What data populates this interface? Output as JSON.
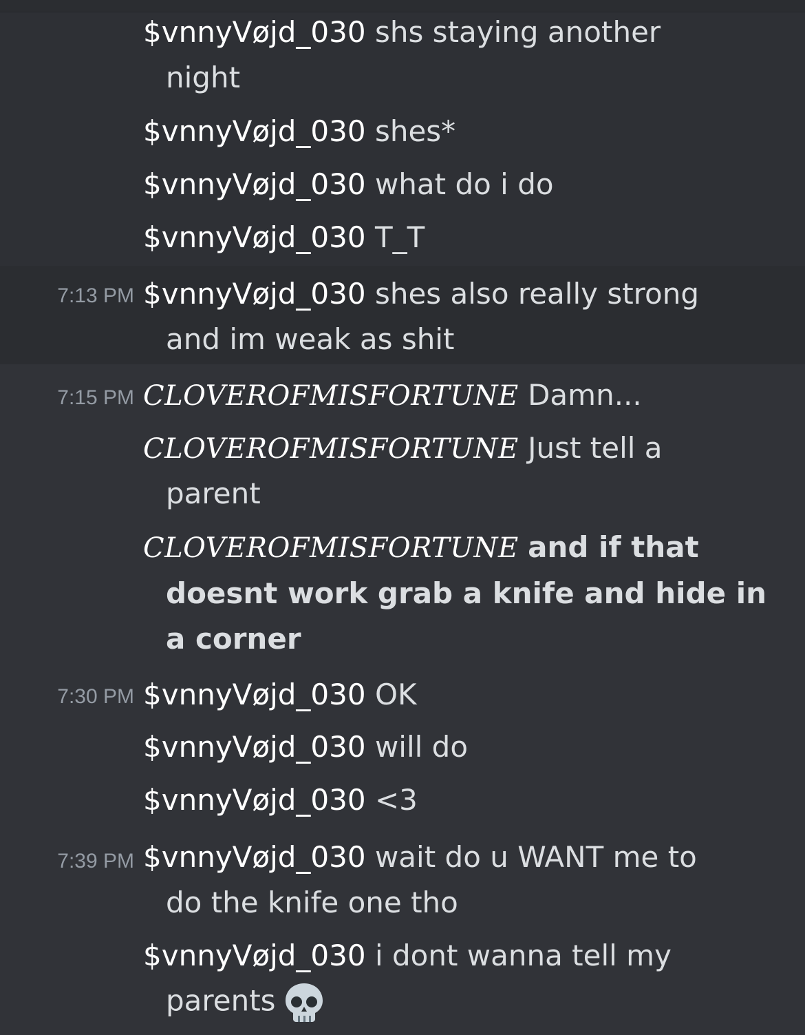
{
  "users": {
    "a": "$vnnyVøjd_030",
    "b": "CLOVEROFMISFORTUNE"
  },
  "messages": [
    {
      "user": "$vnnyVøjd_030",
      "line1": "shs staying another",
      "line2": "night"
    },
    {
      "user": "$vnnyVøjd_030",
      "line1": "shes*"
    },
    {
      "user": "$vnnyVøjd_030",
      "line1": "what do i do"
    },
    {
      "user": "$vnnyVøjd_030",
      "line1": "T_T"
    },
    {
      "time": "7:13 PM",
      "user": "$vnnyVøjd_030",
      "line1": "shes also really strong",
      "line2": "and im weak as shit"
    },
    {
      "time": "7:15 PM",
      "user": "CLOVEROFMISFORTUNE",
      "line1": "Damn..."
    },
    {
      "user": "CLOVEROFMISFORTUNE",
      "line1": "Just tell a",
      "line2": "parent"
    },
    {
      "user": "CLOVEROFMISFORTUNE",
      "line1": "and if that",
      "line2": "doesnt work grab a knife and hide in",
      "line3": "a corner"
    },
    {
      "time": "7:30 PM",
      "user": "$vnnyVøjd_030",
      "line1": "OK"
    },
    {
      "user": "$vnnyVøjd_030",
      "line1": "will do"
    },
    {
      "user": "$vnnyVøjd_030",
      "line1": "<3"
    },
    {
      "time": "7:39 PM",
      "user": "$vnnyVøjd_030",
      "line1": "wait do u WANT me to",
      "line2": "do the knife one tho"
    },
    {
      "user": "$vnnyVøjd_030",
      "line1": "i dont wanna tell my",
      "line2": "parents",
      "emoji": "skull-icon"
    }
  ],
  "colors": {
    "background": "#313338",
    "highlight": "#2e3035",
    "username": "#ffffff",
    "text": "#dbdee1",
    "timestamp": "#949ba4"
  }
}
